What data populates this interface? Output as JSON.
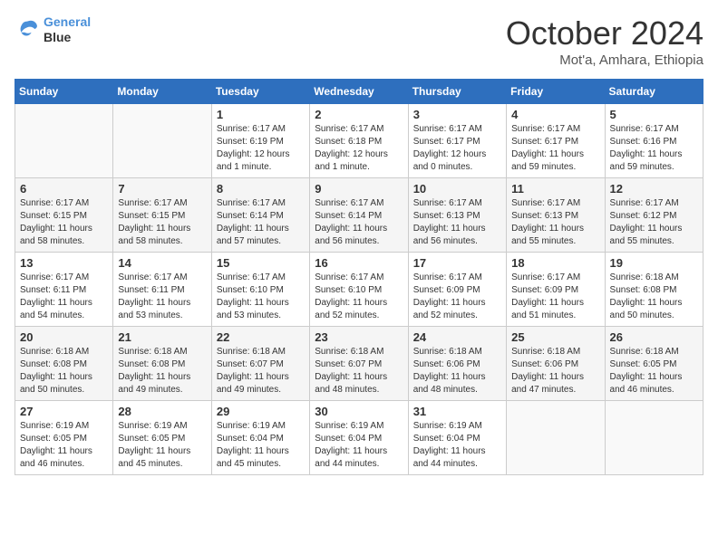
{
  "header": {
    "logo_line1": "General",
    "logo_line2": "Blue",
    "month": "October 2024",
    "location": "Mot'a, Amhara, Ethiopia"
  },
  "days_of_week": [
    "Sunday",
    "Monday",
    "Tuesday",
    "Wednesday",
    "Thursday",
    "Friday",
    "Saturday"
  ],
  "weeks": [
    [
      {
        "num": "",
        "info": ""
      },
      {
        "num": "",
        "info": ""
      },
      {
        "num": "1",
        "info": "Sunrise: 6:17 AM\nSunset: 6:19 PM\nDaylight: 12 hours\nand 1 minute."
      },
      {
        "num": "2",
        "info": "Sunrise: 6:17 AM\nSunset: 6:18 PM\nDaylight: 12 hours\nand 1 minute."
      },
      {
        "num": "3",
        "info": "Sunrise: 6:17 AM\nSunset: 6:17 PM\nDaylight: 12 hours\nand 0 minutes."
      },
      {
        "num": "4",
        "info": "Sunrise: 6:17 AM\nSunset: 6:17 PM\nDaylight: 11 hours\nand 59 minutes."
      },
      {
        "num": "5",
        "info": "Sunrise: 6:17 AM\nSunset: 6:16 PM\nDaylight: 11 hours\nand 59 minutes."
      }
    ],
    [
      {
        "num": "6",
        "info": "Sunrise: 6:17 AM\nSunset: 6:15 PM\nDaylight: 11 hours\nand 58 minutes."
      },
      {
        "num": "7",
        "info": "Sunrise: 6:17 AM\nSunset: 6:15 PM\nDaylight: 11 hours\nand 58 minutes."
      },
      {
        "num": "8",
        "info": "Sunrise: 6:17 AM\nSunset: 6:14 PM\nDaylight: 11 hours\nand 57 minutes."
      },
      {
        "num": "9",
        "info": "Sunrise: 6:17 AM\nSunset: 6:14 PM\nDaylight: 11 hours\nand 56 minutes."
      },
      {
        "num": "10",
        "info": "Sunrise: 6:17 AM\nSunset: 6:13 PM\nDaylight: 11 hours\nand 56 minutes."
      },
      {
        "num": "11",
        "info": "Sunrise: 6:17 AM\nSunset: 6:13 PM\nDaylight: 11 hours\nand 55 minutes."
      },
      {
        "num": "12",
        "info": "Sunrise: 6:17 AM\nSunset: 6:12 PM\nDaylight: 11 hours\nand 55 minutes."
      }
    ],
    [
      {
        "num": "13",
        "info": "Sunrise: 6:17 AM\nSunset: 6:11 PM\nDaylight: 11 hours\nand 54 minutes."
      },
      {
        "num": "14",
        "info": "Sunrise: 6:17 AM\nSunset: 6:11 PM\nDaylight: 11 hours\nand 53 minutes."
      },
      {
        "num": "15",
        "info": "Sunrise: 6:17 AM\nSunset: 6:10 PM\nDaylight: 11 hours\nand 53 minutes."
      },
      {
        "num": "16",
        "info": "Sunrise: 6:17 AM\nSunset: 6:10 PM\nDaylight: 11 hours\nand 52 minutes."
      },
      {
        "num": "17",
        "info": "Sunrise: 6:17 AM\nSunset: 6:09 PM\nDaylight: 11 hours\nand 52 minutes."
      },
      {
        "num": "18",
        "info": "Sunrise: 6:17 AM\nSunset: 6:09 PM\nDaylight: 11 hours\nand 51 minutes."
      },
      {
        "num": "19",
        "info": "Sunrise: 6:18 AM\nSunset: 6:08 PM\nDaylight: 11 hours\nand 50 minutes."
      }
    ],
    [
      {
        "num": "20",
        "info": "Sunrise: 6:18 AM\nSunset: 6:08 PM\nDaylight: 11 hours\nand 50 minutes."
      },
      {
        "num": "21",
        "info": "Sunrise: 6:18 AM\nSunset: 6:08 PM\nDaylight: 11 hours\nand 49 minutes."
      },
      {
        "num": "22",
        "info": "Sunrise: 6:18 AM\nSunset: 6:07 PM\nDaylight: 11 hours\nand 49 minutes."
      },
      {
        "num": "23",
        "info": "Sunrise: 6:18 AM\nSunset: 6:07 PM\nDaylight: 11 hours\nand 48 minutes."
      },
      {
        "num": "24",
        "info": "Sunrise: 6:18 AM\nSunset: 6:06 PM\nDaylight: 11 hours\nand 48 minutes."
      },
      {
        "num": "25",
        "info": "Sunrise: 6:18 AM\nSunset: 6:06 PM\nDaylight: 11 hours\nand 47 minutes."
      },
      {
        "num": "26",
        "info": "Sunrise: 6:18 AM\nSunset: 6:05 PM\nDaylight: 11 hours\nand 46 minutes."
      }
    ],
    [
      {
        "num": "27",
        "info": "Sunrise: 6:19 AM\nSunset: 6:05 PM\nDaylight: 11 hours\nand 46 minutes."
      },
      {
        "num": "28",
        "info": "Sunrise: 6:19 AM\nSunset: 6:05 PM\nDaylight: 11 hours\nand 45 minutes."
      },
      {
        "num": "29",
        "info": "Sunrise: 6:19 AM\nSunset: 6:04 PM\nDaylight: 11 hours\nand 45 minutes."
      },
      {
        "num": "30",
        "info": "Sunrise: 6:19 AM\nSunset: 6:04 PM\nDaylight: 11 hours\nand 44 minutes."
      },
      {
        "num": "31",
        "info": "Sunrise: 6:19 AM\nSunset: 6:04 PM\nDaylight: 11 hours\nand 44 minutes."
      },
      {
        "num": "",
        "info": ""
      },
      {
        "num": "",
        "info": ""
      }
    ]
  ]
}
